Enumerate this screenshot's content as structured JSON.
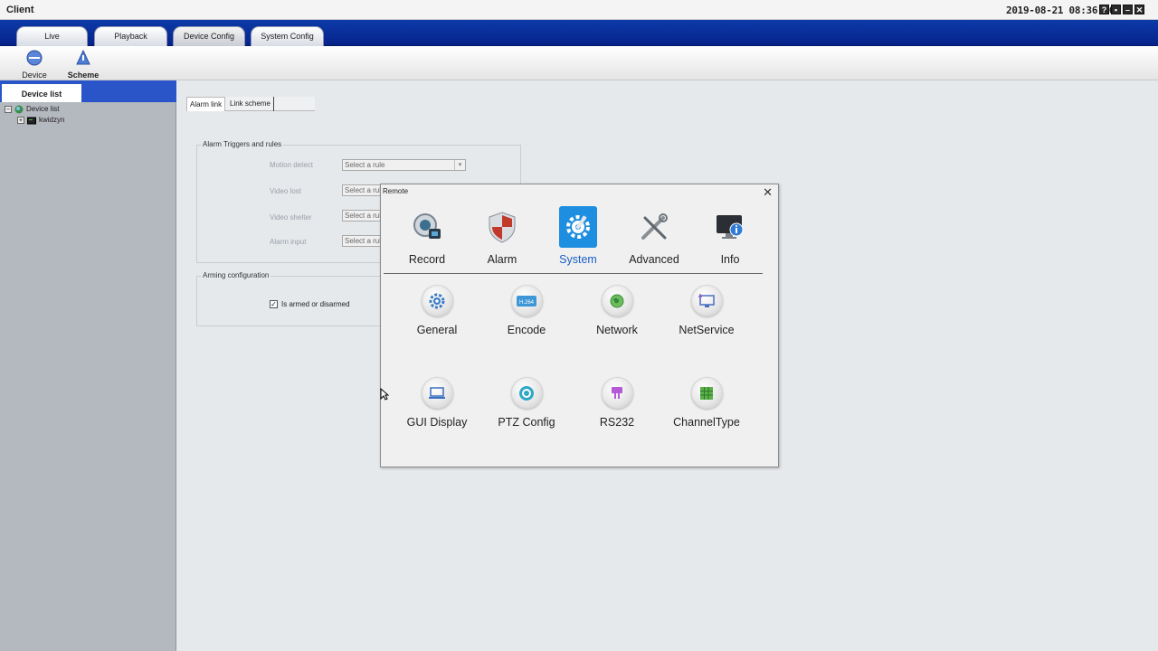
{
  "window": {
    "title": "Client",
    "clock": "2019-08-21 08:36:36",
    "controls": [
      "?",
      "lock",
      "minimize",
      "close"
    ]
  },
  "topnav": {
    "tabs": [
      {
        "label": "Live"
      },
      {
        "label": "Playback"
      },
      {
        "label": "Device Config",
        "active": true
      },
      {
        "label": "System Config"
      }
    ]
  },
  "toolbar": {
    "device_label": "Device",
    "scheme_label": "Scheme"
  },
  "sidebar": {
    "tab_label": "Device list",
    "tree": {
      "root_label": "Device list",
      "child_label": "kwidzyn"
    }
  },
  "main": {
    "subtabs": [
      "Alarm link",
      "Link scheme"
    ],
    "alarm_group": {
      "legend": "Alarm Triggers and rules",
      "rows": [
        {
          "label": "Motion detect",
          "value": "Select a rule"
        },
        {
          "label": "Video lost",
          "value": "Select a rule"
        },
        {
          "label": "Video shelter",
          "value": "Select a rule"
        },
        {
          "label": "Alarm input",
          "value": "Select a rule"
        }
      ]
    },
    "arming_group": {
      "legend": "Arming configuration",
      "checkbox_label": "Is armed or disarmed",
      "checked": true
    }
  },
  "dialog": {
    "title": "Remote",
    "categories": [
      {
        "label": "Record",
        "icon": "record-icon"
      },
      {
        "label": "Alarm",
        "icon": "alarm-shield-icon"
      },
      {
        "label": "System",
        "icon": "system-gear-icon",
        "active": true
      },
      {
        "label": "Advanced",
        "icon": "tools-icon"
      },
      {
        "label": "Info",
        "icon": "info-monitor-icon"
      }
    ],
    "items": [
      {
        "label": "General",
        "icon": "gear-icon"
      },
      {
        "label": "Encode",
        "icon": "h264-icon",
        "badge": "H.264"
      },
      {
        "label": "Network",
        "icon": "globe-icon"
      },
      {
        "label": "NetService",
        "icon": "net-service-icon"
      },
      {
        "label": "GUI Display",
        "icon": "laptop-icon"
      },
      {
        "label": "PTZ Config",
        "icon": "ptz-icon"
      },
      {
        "label": "RS232",
        "icon": "rs232-icon"
      },
      {
        "label": "ChannelType",
        "icon": "channel-grid-icon"
      }
    ]
  },
  "colors": {
    "nav_blue": "#0b3aa8",
    "sidebar_gray": "#b4b8bf",
    "active_accent": "#1e8ee0",
    "active_text": "#1b5fc7"
  }
}
